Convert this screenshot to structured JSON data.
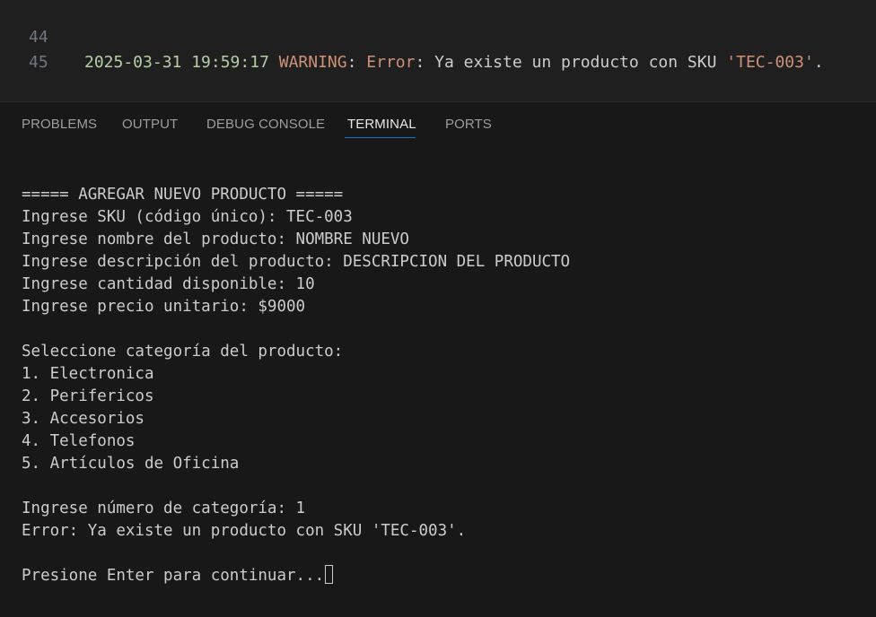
{
  "editor": {
    "lines": [
      {
        "number": "44",
        "date": "2025-03-31 19:59:17",
        "level": "WARNING",
        "sep1": ": ",
        "error_word": "Error",
        "message": ": Ya existe un producto con SKU ",
        "sku_quoted": "'TEC-003'",
        "end": "."
      },
      {
        "number": "45"
      }
    ]
  },
  "panel": {
    "tabs": [
      {
        "label": "PROBLEMS"
      },
      {
        "label": "OUTPUT"
      },
      {
        "label": "DEBUG CONSOLE"
      },
      {
        "label": "TERMINAL",
        "active": true
      },
      {
        "label": "PORTS"
      }
    ],
    "active_tab": "TERMINAL"
  },
  "terminal": {
    "lines": [
      "===== AGREGAR NUEVO PRODUCTO =====",
      "Ingrese SKU (código único): TEC-003",
      "Ingrese nombre del producto: NOMBRE NUEVO",
      "Ingrese descripción del producto: DESCRIPCION DEL PRODUCTO",
      "Ingrese cantidad disponible: 10",
      "Ingrese precio unitario: $9000",
      "",
      "Seleccione categoría del producto:",
      "1. Electronica",
      "2. Perifericos",
      "3. Accesorios",
      "4. Telefonos",
      "5. Artículos de Oficina",
      "",
      "Ingrese número de categoría: 1",
      "Error: Ya existe un producto con SKU 'TEC-003'.",
      "",
      "Presione Enter para continuar..."
    ]
  },
  "colors": {
    "background": "#181818",
    "editor_background": "#1f1f1f",
    "text": "#cccccc",
    "date": "#b5cea8",
    "warning": "#ce9178",
    "active_tab_underline": "#0078d4"
  }
}
